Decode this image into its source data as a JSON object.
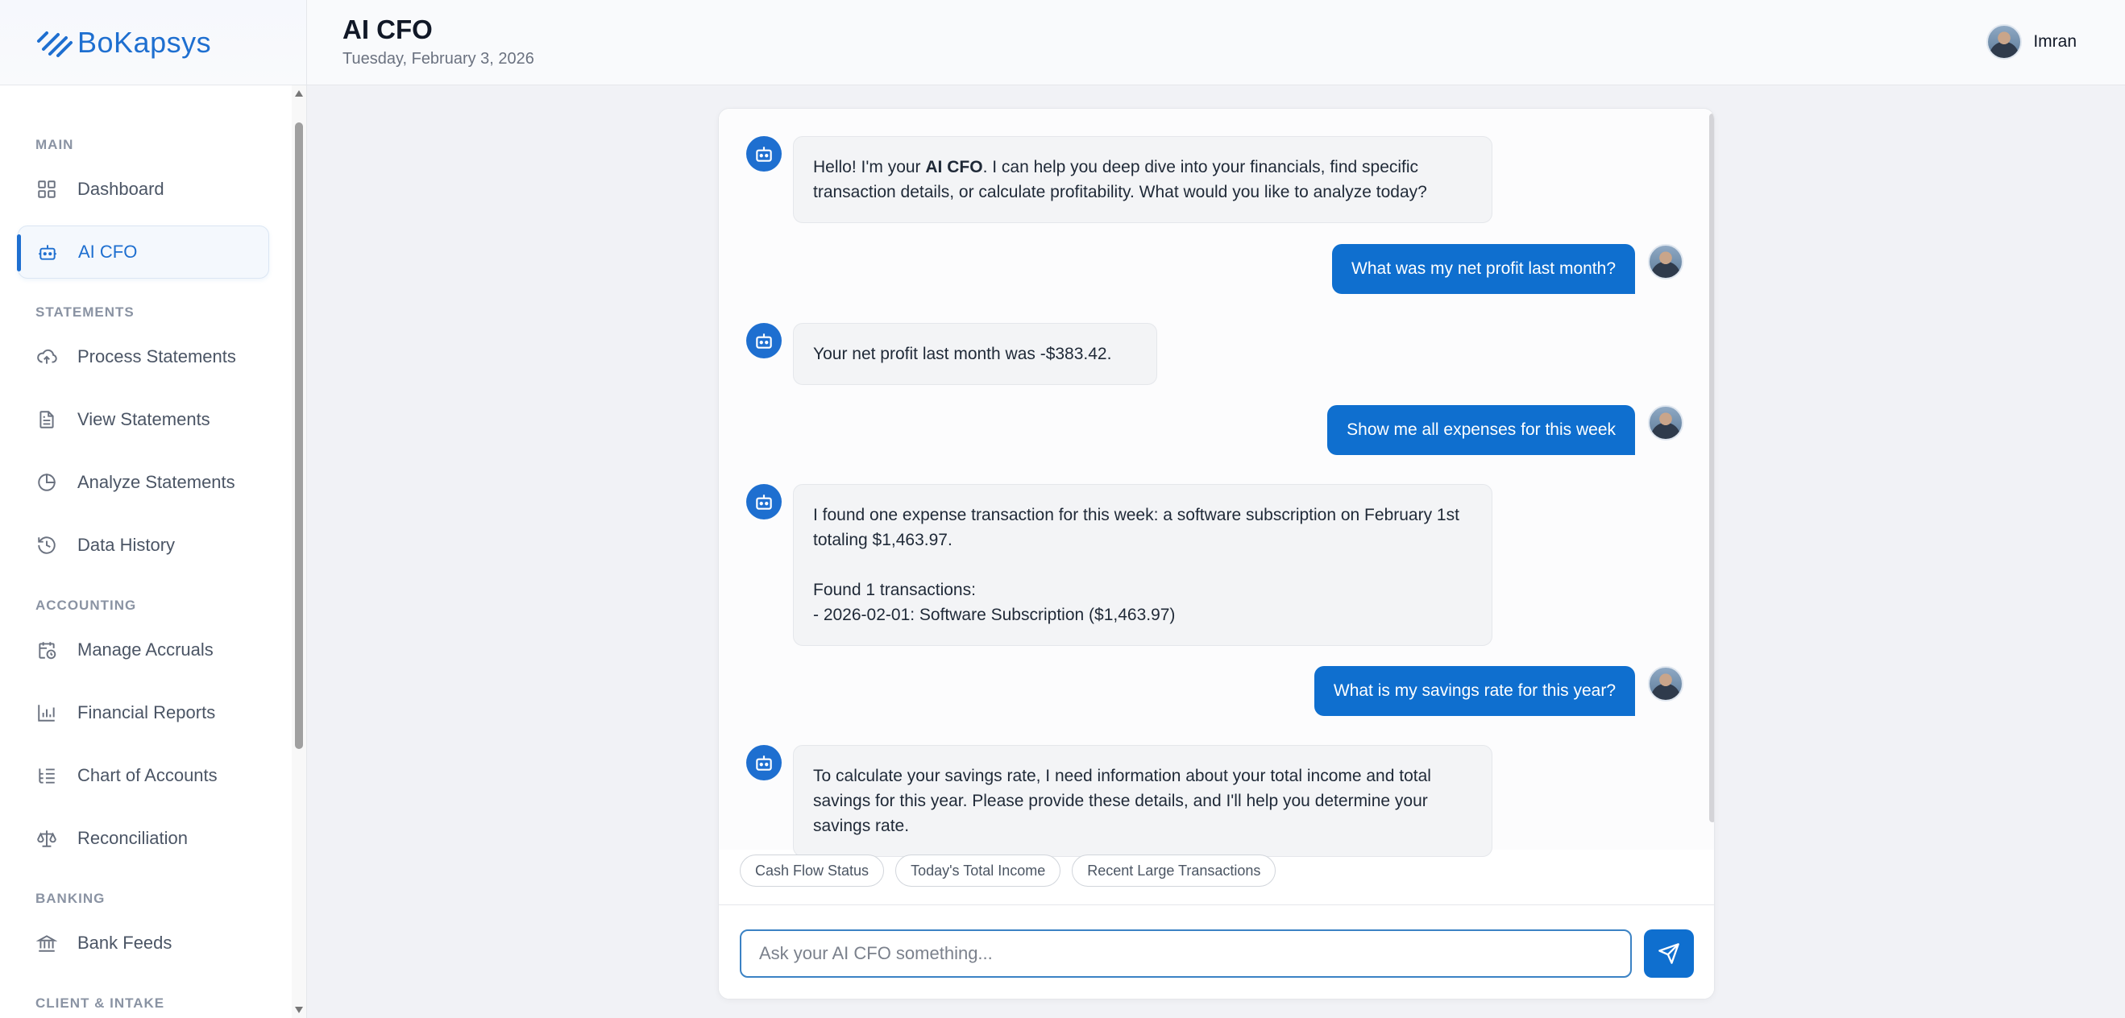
{
  "brand": {
    "name": "BoKapsys",
    "color": "#1e6fd0"
  },
  "header": {
    "title": "AI CFO",
    "date": "Tuesday, February 3, 2026",
    "user_name": "Imran"
  },
  "sidebar": {
    "sections": {
      "main": "MAIN",
      "statements": "STATEMENTS",
      "accounting": "ACCOUNTING",
      "banking": "BANKING",
      "client": "CLIENT & INTAKE"
    },
    "items": [
      {
        "label": "Dashboard",
        "icon": "grid-icon"
      },
      {
        "label": "AI CFO",
        "icon": "robot-icon",
        "active": true
      },
      {
        "label": "Process Statements",
        "icon": "cloud-upload-icon"
      },
      {
        "label": "View Statements",
        "icon": "document-icon"
      },
      {
        "label": "Analyze Statements",
        "icon": "pie-chart-icon"
      },
      {
        "label": "Data History",
        "icon": "history-icon"
      },
      {
        "label": "Manage Accruals",
        "icon": "calendar-clock-icon"
      },
      {
        "label": "Financial Reports",
        "icon": "bar-chart-icon"
      },
      {
        "label": "Chart of Accounts",
        "icon": "list-tree-icon"
      },
      {
        "label": "Reconciliation",
        "icon": "scale-icon"
      },
      {
        "label": "Bank Feeds",
        "icon": "bank-icon"
      }
    ]
  },
  "chat": {
    "messages": [
      {
        "role": "bot",
        "pre": "Hello! I'm your ",
        "bold": "AI CFO",
        "post": ". I can help you deep dive into your financials, find specific transaction details, or calculate profitability. What would you like to analyze today?"
      },
      {
        "role": "user",
        "text": "What was my net profit last month?"
      },
      {
        "role": "bot",
        "text": "Your net profit last month was -$383.42."
      },
      {
        "role": "user",
        "text": "Show me all expenses for this week"
      },
      {
        "role": "bot",
        "text": "I found one expense transaction for this week: a software subscription on February 1st totaling $1,463.97.\n\nFound 1 transactions:\n- 2026-02-01: Software Subscription ($1,463.97)"
      },
      {
        "role": "user",
        "text": "What is my savings rate for this year?"
      },
      {
        "role": "bot",
        "text": "To calculate your savings rate, I need information about your total income and total savings for this year. Please provide these details, and I'll help you determine your savings rate."
      }
    ],
    "suggestions": [
      "Cash Flow Status",
      "Today's Total Income",
      "Recent Large Transactions"
    ],
    "input": {
      "value": "",
      "placeholder": "Ask your AI CFO something..."
    }
  }
}
